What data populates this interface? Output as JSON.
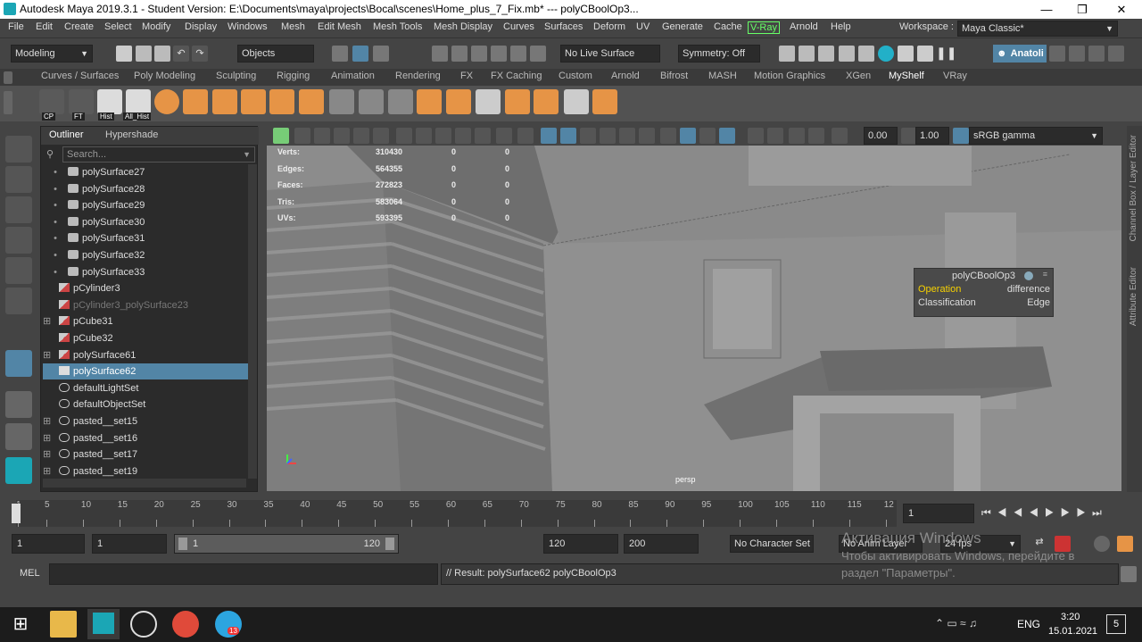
{
  "title_bar": {
    "app_title": "Autodesk Maya 2019.3.1 - Student Version: E:\\Documents\\maya\\projects\\Bocal\\scenes\\Home_plus_7_Fix.mb*   ---   polyCBoolOp3..."
  },
  "menu": [
    "File",
    "Edit",
    "Create",
    "Select",
    "Modify",
    "Display",
    "Windows",
    "Mesh",
    "Edit Mesh",
    "Mesh Tools",
    "Mesh Display",
    "Curves",
    "Surfaces",
    "Deform",
    "UV",
    "Generate",
    "Cache",
    "V-Ray",
    "Arnold",
    "Help"
  ],
  "workspace": {
    "label": "Workspace :",
    "value": "Maya Classic*"
  },
  "status_line": {
    "mode": "Modeling",
    "objects": "Objects",
    "live_surface": "No Live Surface",
    "symmetry": "Symmetry: Off",
    "user": "Anatoli"
  },
  "shelf_tabs": [
    "Curves / Surfaces",
    "Poly Modeling",
    "Sculpting",
    "Rigging",
    "Animation",
    "Rendering",
    "FX",
    "FX Caching",
    "Custom",
    "Arnold",
    "Bifrost",
    "MASH",
    "Motion Graphics",
    "XGen",
    "MyShelf",
    "VRay"
  ],
  "active_shelf": "MyShelf",
  "shelf_labels": [
    "CP",
    "FT",
    "Hist",
    "All_Hist"
  ],
  "outliner": {
    "tabs": [
      "Outliner",
      "Hypershade"
    ],
    "search_placeholder": "Search...",
    "items": [
      {
        "label": "polySurface27"
      },
      {
        "label": "polySurface28"
      },
      {
        "label": "polySurface29"
      },
      {
        "label": "polySurface30"
      },
      {
        "label": "polySurface31"
      },
      {
        "label": "polySurface32"
      },
      {
        "label": "polySurface33"
      },
      {
        "label": "pCylinder3"
      },
      {
        "label": "pCylinder3_polySurface23"
      },
      {
        "label": "pCube31"
      },
      {
        "label": "pCube32"
      },
      {
        "label": "polySurface61"
      },
      {
        "label": "polySurface62"
      },
      {
        "label": "defaultLightSet"
      },
      {
        "label": "defaultObjectSet"
      },
      {
        "label": "pasted__set15"
      },
      {
        "label": "pasted__set16"
      },
      {
        "label": "pasted__set17"
      },
      {
        "label": "pasted__set19"
      }
    ]
  },
  "viewport_toolbar": {
    "exposure": "0.00",
    "gamma": "1.00",
    "color_space": "sRGB gamma"
  },
  "hud": [
    {
      "label": "Verts:",
      "v1": "310430",
      "v2": "0",
      "v3": "0"
    },
    {
      "label": "Edges:",
      "v1": "564355",
      "v2": "0",
      "v3": "0"
    },
    {
      "label": "Faces:",
      "v1": "272823",
      "v2": "0",
      "v3": "0"
    },
    {
      "label": "Tris:",
      "v1": "583064",
      "v2": "0",
      "v3": "0"
    },
    {
      "label": "UVs:",
      "v1": "593395",
      "v2": "0",
      "v3": "0"
    }
  ],
  "camera_label": "persp",
  "node_box": {
    "title": "polyCBoolOp3",
    "rows": [
      {
        "k": "Operation",
        "v": "difference"
      },
      {
        "k": "Classification",
        "v": "Edge"
      }
    ]
  },
  "right_strip": [
    "Channel Box / Layer Editor",
    "Attribute Editor"
  ],
  "timeline": {
    "ticks": [
      "1",
      "5",
      "10",
      "15",
      "20",
      "25",
      "30",
      "35",
      "40",
      "45",
      "50",
      "55",
      "60",
      "65",
      "70",
      "75",
      "80",
      "85",
      "90",
      "95",
      "100",
      "105",
      "110",
      "115",
      "12"
    ],
    "current_frame": "1"
  },
  "range": {
    "start": "1",
    "anim_start": "1",
    "slider_start": "1",
    "slider_end": "120",
    "end": "120",
    "anim_end": "200",
    "character_set": "No Character Set",
    "anim_layer": "No Anim Layer",
    "fps": "24 fps"
  },
  "command_line": {
    "lang": "MEL",
    "result": "// Result: polySurface62 polyCBoolOp3"
  },
  "activation": {
    "line1": "Активация Windows",
    "line2": "Чтобы активировать Windows, перейдите в",
    "line3": "раздел \"Параметры\"."
  },
  "taskbar": {
    "lang": "ENG",
    "time": "3:20",
    "date": "15.01.2021",
    "notif": "5",
    "telegram_badge": "13"
  }
}
